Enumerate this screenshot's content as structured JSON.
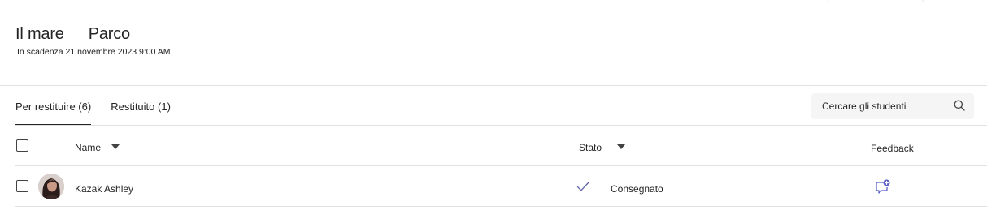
{
  "header": {
    "title": "Il mare",
    "title_secondary": "Parco",
    "due_text": "In scadenza 21 novembre 2023 9:00 AM"
  },
  "tabs": [
    {
      "label": "Per restituire (6)",
      "active": true
    },
    {
      "label": "Restituito (1)",
      "active": false
    }
  ],
  "search": {
    "placeholder": "Cercare gli studenti",
    "value": "",
    "icon": "search-icon"
  },
  "table": {
    "columns": {
      "name": "Name",
      "status": "Stato",
      "feedback": "Feedback"
    },
    "rows": [
      {
        "name": "Kazak Ashley",
        "status": "Consegnato",
        "status_icon": "check-icon",
        "feedback_icon": "feedback-add-icon",
        "selected": false
      }
    ]
  },
  "colors": {
    "accent": "#5b5fc7",
    "status_check": "#6264a7",
    "text": "#242424",
    "divider": "#e1e1e1"
  }
}
